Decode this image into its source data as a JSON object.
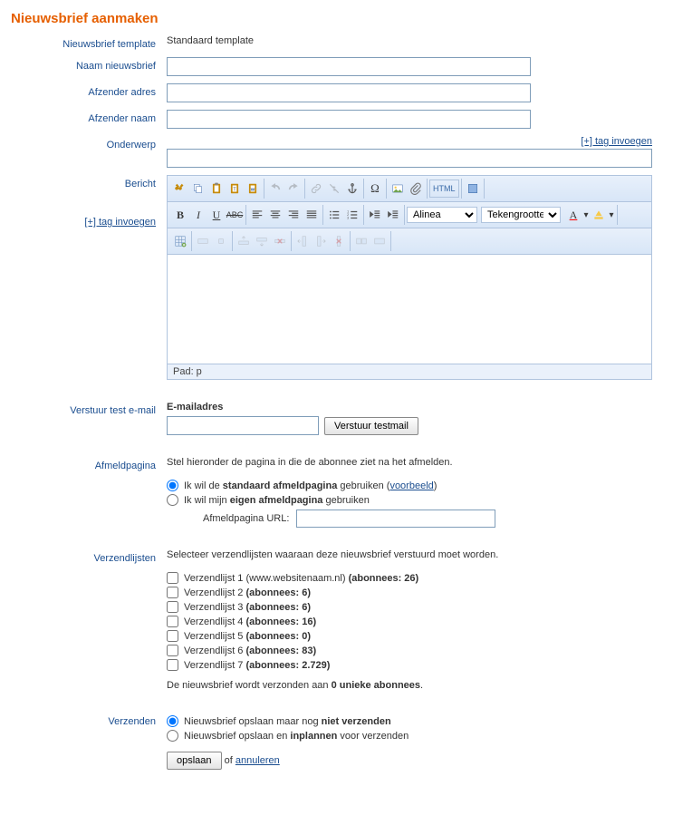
{
  "title": "Nieuwsbrief aanmaken",
  "labels": {
    "template": "Nieuwsbrief template",
    "name": "Naam nieuwsbrief",
    "sender_addr": "Afzender adres",
    "sender_name": "Afzender naam",
    "subject": "Onderwerp",
    "message": "Bericht",
    "tag_insert": "[+] tag invoegen",
    "test_email": "Verstuur test e-mail",
    "unsubscribe": "Afmeldpagina",
    "lists": "Verzendlijsten",
    "send": "Verzenden"
  },
  "template_value": "Standaard template",
  "editor": {
    "format_select": "Alinea",
    "fontsize_select": "Tekengrootte",
    "path": "Pad: p"
  },
  "test": {
    "label": "E-mailadres",
    "button": "Verstuur testmail"
  },
  "unsubscribe": {
    "intro": "Stel hieronder de pagina in die de abonnee ziet na het afmelden.",
    "opt_default_pre": "Ik wil de ",
    "opt_default_bold": "standaard afmeldpagina",
    "opt_default_post": " gebruiken (",
    "example_link": "voorbeeld",
    "opt_default_close": ")",
    "opt_own_pre": "Ik wil mijn ",
    "opt_own_bold": "eigen afmeldpagina",
    "opt_own_post": " gebruiken",
    "url_label": "Afmeldpagina URL:"
  },
  "lists": {
    "intro": "Selecteer verzendlijsten waaraan deze nieuwsbrief verstuurd moet worden.",
    "items": [
      {
        "name": "Verzendlijst 1 (www.websitenaam.nl)",
        "sub": "(abonnees: 26)"
      },
      {
        "name": "Verzendlijst 2",
        "sub": "(abonnees: 6)"
      },
      {
        "name": "Verzendlijst 3",
        "sub": "(abonnees: 6)"
      },
      {
        "name": "Verzendlijst 4",
        "sub": "(abonnees: 16)"
      },
      {
        "name": "Verzendlijst 5",
        "sub": "(abonnees: 0)"
      },
      {
        "name": "Verzendlijst 6",
        "sub": "(abonnees: 83)"
      },
      {
        "name": "Verzendlijst 7",
        "sub": "(abonnees: 2.729)"
      }
    ],
    "summary_pre": "De nieuwsbrief wordt verzonden aan ",
    "summary_count": "0 unieke abonnees",
    "summary_post": "."
  },
  "send": {
    "opt_save_pre": "Nieuwsbrief opslaan maar nog ",
    "opt_save_bold": "niet verzenden",
    "opt_sched_pre": "Nieuwsbrief opslaan en ",
    "opt_sched_bold": "inplannen",
    "opt_sched_post": " voor verzenden",
    "save_btn": "opslaan",
    "or": " of ",
    "cancel": "annuleren"
  }
}
